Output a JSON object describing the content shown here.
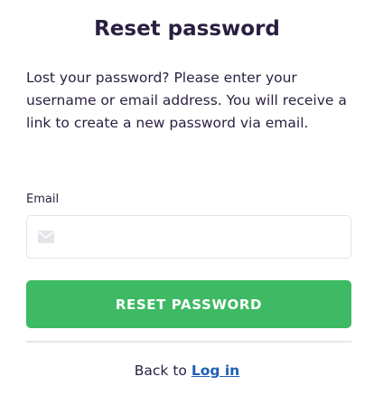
{
  "heading": "Reset password",
  "description": "Lost your password? Please enter your username or email address. You will receive a link to create a new password via email.",
  "email_field": {
    "label": "Email",
    "value": "",
    "placeholder": "",
    "icon": "envelope-icon"
  },
  "submit_label": "RESET PASSWORD",
  "back": {
    "prefix": "Back to",
    "link_label": "Log in"
  },
  "colors": {
    "text": "#2a1f40",
    "button": "#3dba63",
    "link": "#1c5fb4",
    "border": "#e2e3e8"
  }
}
